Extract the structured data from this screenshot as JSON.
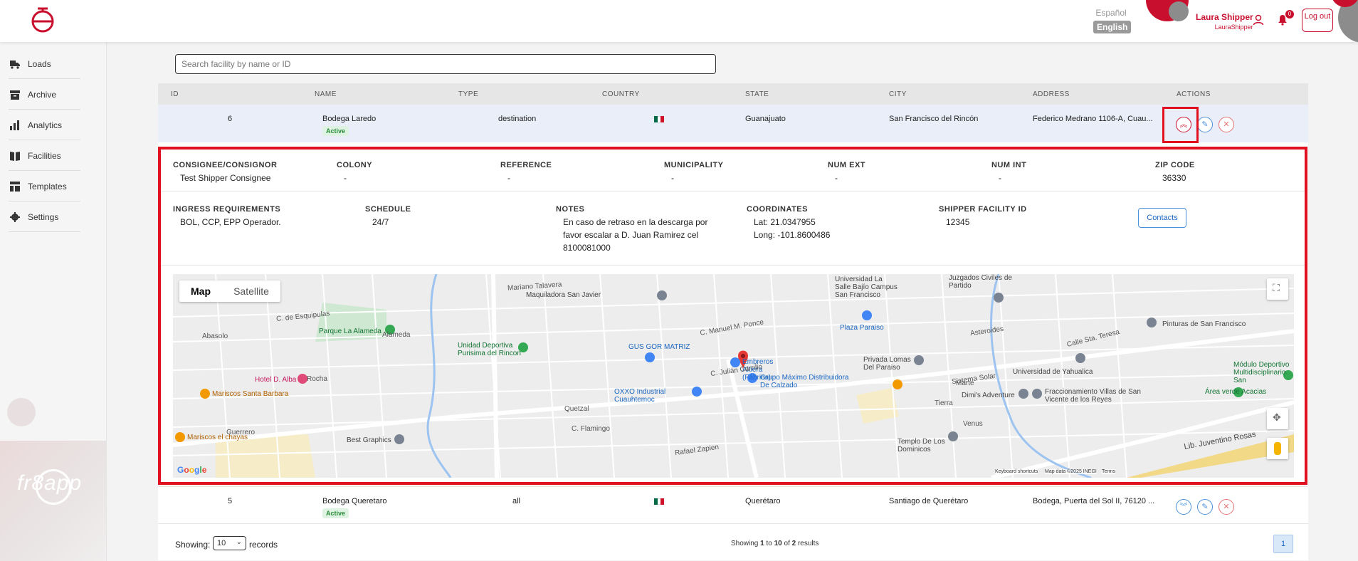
{
  "header": {
    "lang_es": "Español",
    "lang_en": "English",
    "user_name": "Laura Shipper",
    "user_handle": "LauraShipper",
    "notif_count": "0",
    "logout_label": "Log out",
    "brand_color": "#c8102e"
  },
  "sidebar": {
    "items": [
      {
        "label": "Loads",
        "icon": "truck-icon"
      },
      {
        "label": "Archive",
        "icon": "archive-icon"
      },
      {
        "label": "Analytics",
        "icon": "bar-chart-icon"
      },
      {
        "label": "Facilities",
        "icon": "book-icon"
      },
      {
        "label": "Templates",
        "icon": "template-icon"
      },
      {
        "label": "Settings",
        "icon": "gear-icon"
      }
    ],
    "brand": "fr8app"
  },
  "search": {
    "placeholder": "Search facility by name or ID"
  },
  "table": {
    "columns": [
      "ID",
      "NAME",
      "TYPE",
      "COUNTRY",
      "STATE",
      "CITY",
      "ADDRESS",
      "ACTIONS"
    ],
    "rows": [
      {
        "id": "6",
        "name": "Bodega Laredo",
        "status": "Active",
        "type": "destination",
        "country": "mexico-flag",
        "state": "Guanajuato",
        "city": "San Francisco del Rincón",
        "address": "Federico Medrano 1106-A, Cuau..."
      },
      {
        "id": "5",
        "name": "Bodega Queretaro",
        "status": "Active",
        "type": "all",
        "country": "mexico-flag",
        "state": "Querétaro",
        "city": "Santiago de Querétaro",
        "address": "Bodega, Puerta del Sol II, 76120 ..."
      }
    ]
  },
  "details": {
    "labels1": [
      "CONSIGNEE/CONSIGNOR",
      "COLONY",
      "REFERENCE",
      "MUNICIPALITY",
      "NUM EXT",
      "NUM INT",
      "ZIP CODE"
    ],
    "values1": [
      "Test Shipper Consignee",
      "-",
      "-",
      "-",
      "-",
      "-",
      "36330"
    ],
    "labels2": [
      "INGRESS REQUIREMENTS",
      "SCHEDULE",
      "NOTES",
      "COORDINATES",
      "SHIPPER FACILITY ID"
    ],
    "ingress": "BOL, CCP, EPP Operador.",
    "schedule": "24/7",
    "notes": [
      "En caso de retraso en la descarga por",
      "favor escalar a D. Juan Ramirez cel",
      "8100081000"
    ],
    "lat": "Lat: 21.0347955",
    "long": "Long: -101.8600486",
    "shipper_facility_id": "12345",
    "contacts_label": "Contacts"
  },
  "map": {
    "tab_map": "Map",
    "tab_satellite": "Satellite",
    "google": "Google",
    "keyboard": "Keyboard shortcuts",
    "mapdata": "Map data ©2025 INEGI",
    "terms": "Terms",
    "places": [
      "Maquiladora San Javier",
      "Parque La Alameda",
      "Unidad Deportiva Purisima del Rincon",
      "GUS GOR MATRIZ",
      "Embreros Altiera (Fábrica)",
      "Grupo Máximo Distribuidora De Calzado",
      "OXXO Industrial Cuauhtemoc",
      "Plaza Paraiso",
      "Privada Lomas Del Paraiso",
      "Dimi's Adventure",
      "Universidad de Yahualica",
      "Fraccionamiento Villas de San Vicente de los Reyes",
      "Área verde Acacias",
      "Pinturas de San Francisco",
      "Hotel D. Alba",
      "Mariscos Santa Barbara",
      "Mariscos el chayas",
      "Best Graphics",
      "Templo De Los Dominicos",
      "Universidad La Salle Bajío Campus San Francisco",
      "Juzgados Civiles de Partido",
      "Módulo Deportivo Multidisciplinario San",
      "Lib. Juventino Rosas",
      "Rafael Zapien",
      "Sistema Solar",
      "C. de Esquipulas",
      "Mariano Talavera",
      "C. Manuel M. Ponce",
      "C. Julián Carrillo",
      "Calle Sta. Teresa",
      "Asteroides",
      "Marte",
      "Tierra",
      "Venus",
      "Guerrero",
      "Rocha",
      "Quetzal",
      "C. Flamingo",
      "Alameda",
      "Abasolo"
    ]
  },
  "footer": {
    "showing": "Showing:",
    "per_page": "10",
    "records": "records",
    "summary_pre": "Showing ",
    "summary_from": "1",
    "summary_to_word": " to ",
    "summary_to": "10",
    "summary_of_word": " of ",
    "summary_total": "2",
    "summary_post": " results",
    "page": "1"
  }
}
